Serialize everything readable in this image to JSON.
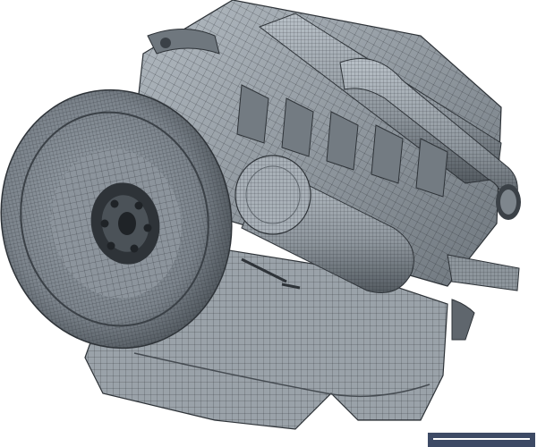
{
  "scene": {
    "subject": "engine-wireframe-render",
    "palette": {
      "background": "#ffffff",
      "surface_light": "#a9b1b8",
      "surface_mid": "#8c949c",
      "surface_dark": "#5f666d",
      "shadow": "#2e3338",
      "wire": "#1f2327"
    }
  }
}
